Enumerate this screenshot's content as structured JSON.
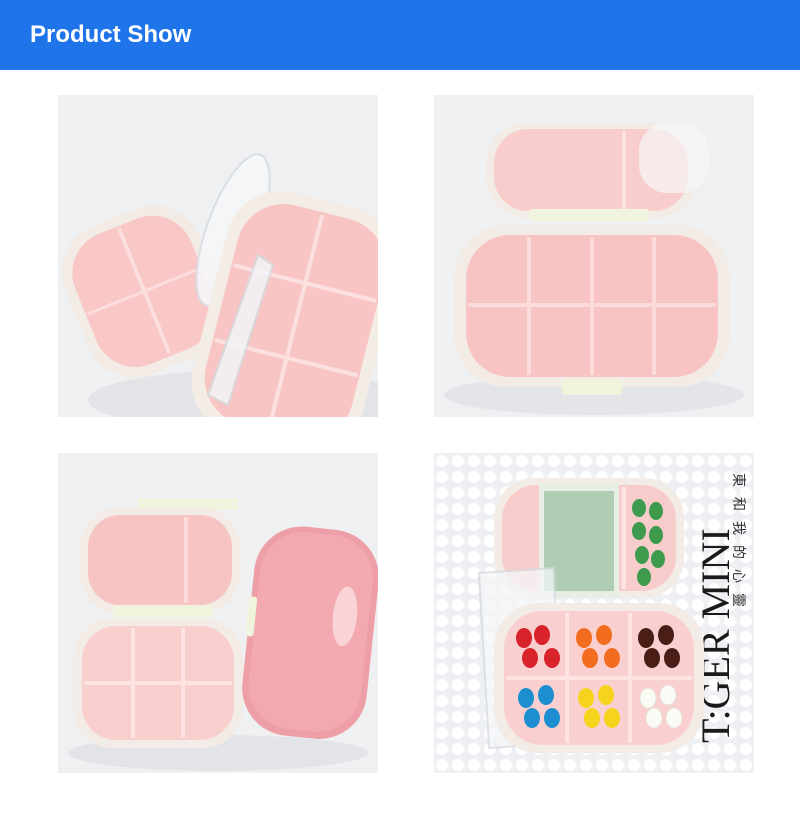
{
  "header": {
    "title": "Product Show",
    "background_color": "#1f74ea"
  },
  "photos": [
    {
      "subject": "open pill box with lid raised, top-left view"
    },
    {
      "subject": "open pill box with lid folded back, front view"
    },
    {
      "subject": "open pill box next to closed pink pill box"
    },
    {
      "subject": "pill box filled with candies and medicine"
    }
  ],
  "photo_4_background_text": {
    "brand": "T:GER MINI",
    "vertical_chars": "東和我的心靈"
  },
  "colors": {
    "pink": "#f7c2c3",
    "light_pink": "#fbd9d8",
    "frame": "#f3ebe6",
    "clasp": "#f1f4dd"
  }
}
